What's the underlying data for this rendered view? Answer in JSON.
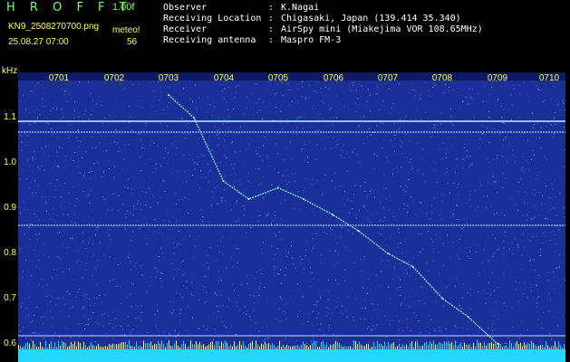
{
  "header": {
    "app_title": "H R O F F T",
    "version": "1.00f",
    "filename": "KN9_2508270700.png",
    "mode": "meteo!",
    "timestamp": "25.08.27 07:00",
    "count": "56",
    "info": [
      {
        "key": "Observer",
        "value": "K.Nagai"
      },
      {
        "key": "Receiving Location",
        "value": "Chigasaki, Japan (139.414 35.340)"
      },
      {
        "key": "Receiver",
        "value": "AirSpy mini (Miakejima VOR 108.65MHz)"
      },
      {
        "key": "Receiving antenna",
        "value": "Maspro FM-3"
      }
    ]
  },
  "colors": {
    "background": "#1a2f9a",
    "label": "#ffff40",
    "title": "#7cff62",
    "signal": "#7fffe0"
  },
  "chart_data": {
    "type": "heatmap",
    "y_unit": "kHz",
    "y_ticks": [
      "1.1",
      "1.0",
      "0.9",
      "0.8",
      "0.7",
      "0.6"
    ],
    "x_ticks": [
      "0701",
      "0702",
      "0703",
      "0704",
      "0705",
      "0706",
      "0707",
      "0708",
      "0709",
      "0710"
    ],
    "ylim": [
      0.58,
      1.19
    ],
    "horizontal_signals_khz": [
      1.092,
      1.068,
      0.862,
      0.618
    ],
    "meteor_trace": [
      {
        "x": "0703",
        "y": 1.15
      },
      {
        "x": "0703",
        "y": 1.1
      },
      {
        "x": "0704",
        "y": 0.96
      },
      {
        "x": "0704",
        "y": 0.92
      },
      {
        "x": "0705",
        "y": 0.945
      },
      {
        "x": "0705",
        "y": 0.92
      },
      {
        "x": "0706",
        "y": 0.885
      },
      {
        "x": "0706",
        "y": 0.85
      },
      {
        "x": "0707",
        "y": 0.8
      },
      {
        "x": "0707",
        "y": 0.77
      },
      {
        "x": "0708",
        "y": 0.7
      },
      {
        "x": "0708",
        "y": 0.66
      },
      {
        "x": "0709",
        "y": 0.6
      }
    ]
  }
}
